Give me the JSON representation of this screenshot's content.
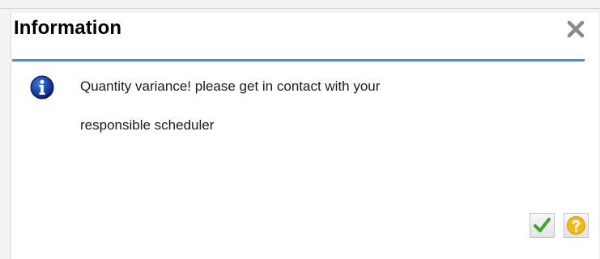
{
  "dialog": {
    "title": "Information",
    "message_line1": "Quantity variance! please get in contact with your",
    "message_line2": "responsible scheduler",
    "icons": {
      "message_type": "info-icon",
      "close": "close-icon",
      "ok": "checkmark-icon",
      "help": "question-icon"
    }
  },
  "colors": {
    "title_rule": "#3d94d6",
    "info_icon": "#0a3fa8",
    "ok_check": "#4aa02c",
    "help_circle": "#f3b81b"
  }
}
